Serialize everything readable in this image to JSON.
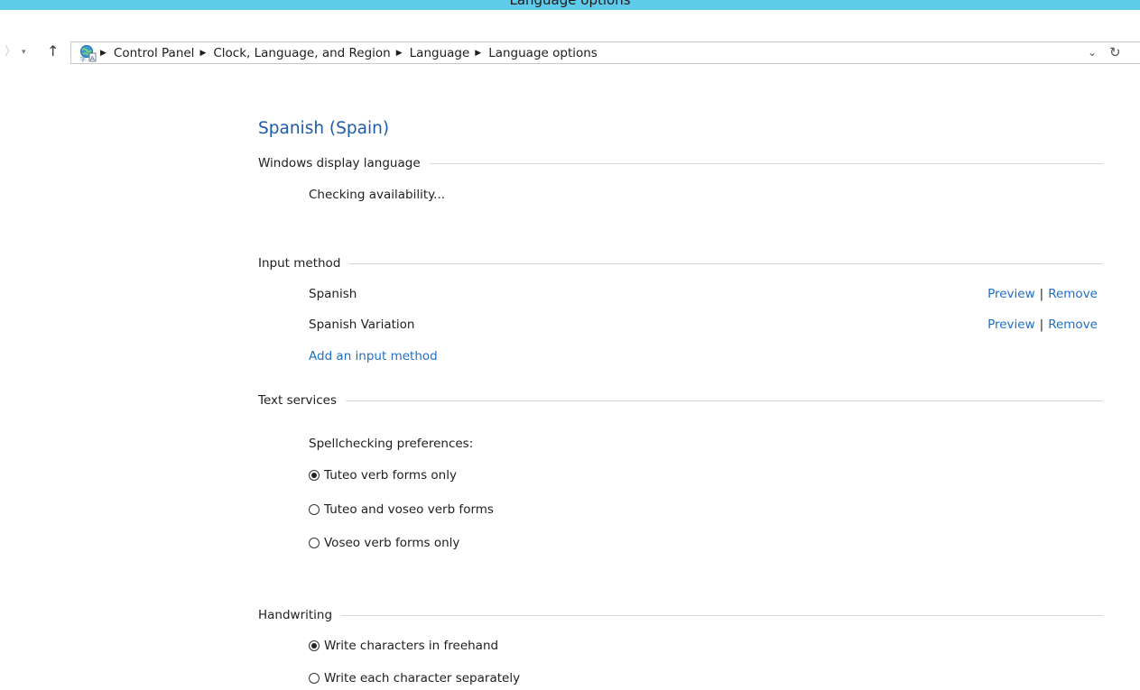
{
  "window": {
    "title": "Language options"
  },
  "nav": {
    "back_glyph": "〉",
    "recent_glyph": "▾",
    "up_glyph": "↑"
  },
  "address": {
    "icon": "control-panel-icon",
    "crumbs": [
      "Control Panel",
      "Clock, Language, and Region",
      "Language",
      "Language options"
    ],
    "dropdown_glyph": "⌄",
    "refresh_glyph": "↻"
  },
  "page": {
    "title": "Spanish (Spain)"
  },
  "display_language": {
    "header": "Windows display language",
    "status": "Checking availability..."
  },
  "input_method": {
    "header": "Input method",
    "methods": [
      {
        "name": "Spanish",
        "preview": "Preview",
        "separator": "|",
        "remove": "Remove"
      },
      {
        "name": "Spanish Variation",
        "preview": "Preview",
        "separator": "|",
        "remove": "Remove"
      }
    ],
    "add_link": "Add an input method"
  },
  "text_services": {
    "header": "Text services",
    "prompt": "Spellchecking preferences:",
    "options": [
      {
        "label": "Tuteo verb forms only",
        "checked": true
      },
      {
        "label": "Tuteo and voseo verb forms",
        "checked": false
      },
      {
        "label": "Voseo verb forms only",
        "checked": false
      }
    ]
  },
  "handwriting": {
    "header": "Handwriting",
    "options": [
      {
        "label": "Write characters in freehand",
        "checked": true
      },
      {
        "label": "Write each character separately",
        "checked": false
      }
    ]
  },
  "colors": {
    "titlebar": "#5fcbea",
    "title_blue": "#1f5ba8",
    "link_blue": "#1f6fc5"
  }
}
